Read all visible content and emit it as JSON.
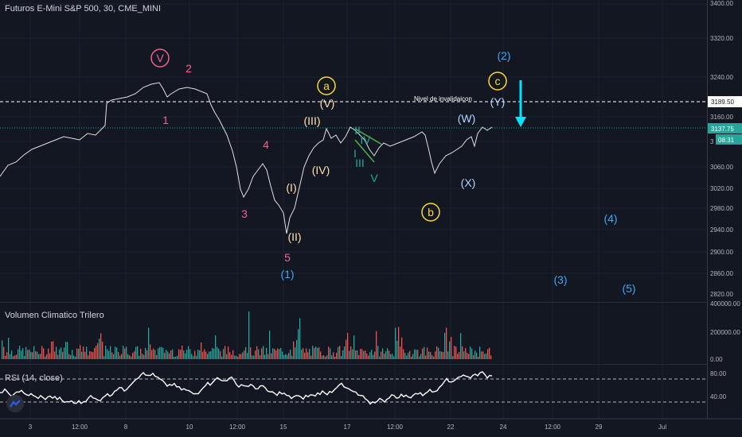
{
  "header": {
    "title": "Futuros E-Mini S&P 500, 30, CME_MINI"
  },
  "price_axis": {
    "ticks": [
      "3400.00",
      "3320.00",
      "3240.00",
      "3160.00",
      "3060.00",
      "3020.00",
      "2980.00",
      "2940.00",
      "2900.00",
      "2860.00",
      "2820.00"
    ],
    "tick_3100": "3",
    "invalidation_label": "3189.50",
    "last_price_label": "3137.75",
    "countdown_label": "08:31"
  },
  "time_axis": {
    "labels": [
      "3",
      "12:00",
      "8",
      "10",
      "12:00",
      "15",
      "17",
      "12:00",
      "22",
      "24",
      "12:00",
      "29",
      "Jul"
    ]
  },
  "annotations": {
    "invalidation_text": "Nivel de invalidaicon",
    "waves": {
      "V_circle": "V",
      "w1": "1",
      "w2": "2",
      "w3": "3",
      "w4": "4",
      "w5": "5",
      "p1": "(1)",
      "p2": "(2)",
      "p3": "(3)",
      "p4": "(4)",
      "p5": "(5)",
      "a": "a",
      "b": "b",
      "c": "c",
      "I": "(I)",
      "II": "(II)",
      "III": "(III)",
      "IV": "(IV)",
      "Vp": "(V)",
      "tI": "I",
      "tII": "II",
      "tIII": "III",
      "tIV": "IV",
      "tV": "V",
      "W": "(W)",
      "X": "(X)",
      "Y": "(Y)"
    }
  },
  "volume_pane": {
    "title": "Volumen Climatico Trilero",
    "ticks": [
      "400000.00",
      "200000.00",
      "0.00"
    ]
  },
  "rsi_pane": {
    "title": "RSI (14, close)",
    "ticks": [
      "80.00",
      "40.00"
    ]
  },
  "colors": {
    "background": "#131722",
    "candle_up": "#26a69a",
    "candle_down": "#ef5350",
    "pink_wave": "#f06292",
    "blue_wave": "#42a5f5",
    "yellow_wave": "#fdd835",
    "teal_wave": "#26a69a",
    "cyan_arrow": "#00e5ff"
  }
}
